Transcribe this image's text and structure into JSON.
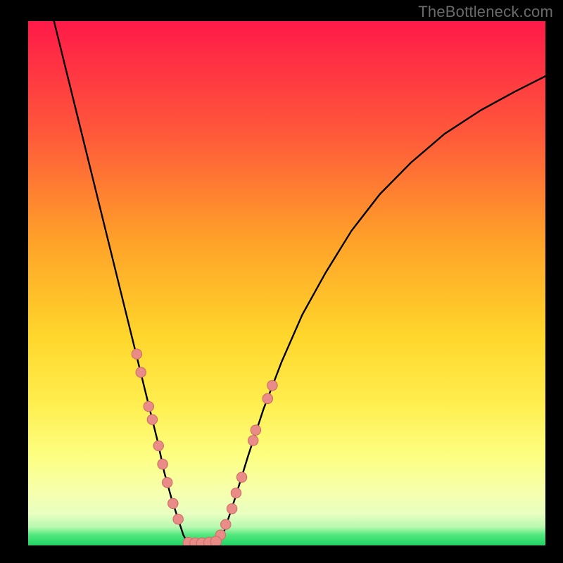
{
  "watermark": "TheBottleneck.com",
  "colors": {
    "bg_black": "#000000",
    "gradient_top": "#ff1a49",
    "gradient_mid1": "#ff7a2e",
    "gradient_mid2": "#ffd52b",
    "gradient_mid3": "#ffee5f",
    "gradient_low": "#f6ff8f",
    "gradient_base_pale": "#f4fec4",
    "gradient_green": "#1ed860",
    "curve": "#000000",
    "marker_fill": "#e98b86",
    "marker_stroke": "#cf6e68"
  },
  "chart_data": {
    "type": "line",
    "title": "",
    "xlabel": "",
    "ylabel": "",
    "xlim": [
      0,
      100
    ],
    "ylim": [
      0,
      100
    ],
    "grid": false,
    "series": [
      {
        "name": "left_branch",
        "x": [
          5,
          7,
          9,
          11,
          13,
          15,
          17,
          19,
          20.5,
          22,
          23.5,
          25,
          26.3,
          27.7,
          29,
          30,
          30.8
        ],
        "y": [
          100,
          92,
          84,
          76,
          68,
          60,
          52,
          44,
          38,
          32,
          26,
          20,
          14,
          9,
          5,
          2,
          0.5
        ]
      },
      {
        "name": "valley_floor",
        "x": [
          30.8,
          32,
          33.2,
          34.5,
          35.6,
          36.8
        ],
        "y": [
          0.5,
          0.2,
          0.2,
          0.2,
          0.3,
          0.6
        ]
      },
      {
        "name": "right_branch",
        "x": [
          36.8,
          38,
          40,
          42.5,
          45.5,
          49,
          53,
          57.5,
          62.5,
          68,
          74,
          80.5,
          87.5,
          94,
          100
        ],
        "y": [
          0.6,
          3,
          9,
          17,
          26,
          35,
          44,
          52,
          60,
          67,
          73,
          78.5,
          83,
          86.5,
          89.5
        ]
      }
    ],
    "markers_left": [
      {
        "x": 21.0,
        "y": 36.5
      },
      {
        "x": 21.8,
        "y": 33.0
      },
      {
        "x": 23.3,
        "y": 26.5
      },
      {
        "x": 24.0,
        "y": 24.0
      },
      {
        "x": 25.2,
        "y": 19.0
      },
      {
        "x": 26.0,
        "y": 15.5
      },
      {
        "x": 26.9,
        "y": 12.0
      },
      {
        "x": 28.0,
        "y": 8.0
      },
      {
        "x": 29.0,
        "y": 5.0
      }
    ],
    "markers_floor": [
      {
        "x": 31.0,
        "y": 0.5
      },
      {
        "x": 32.3,
        "y": 0.4
      },
      {
        "x": 33.6,
        "y": 0.4
      },
      {
        "x": 35.0,
        "y": 0.5
      },
      {
        "x": 36.3,
        "y": 0.7
      }
    ],
    "markers_right": [
      {
        "x": 37.2,
        "y": 2.0
      },
      {
        "x": 38.2,
        "y": 4.0
      },
      {
        "x": 39.4,
        "y": 7.0
      },
      {
        "x": 40.2,
        "y": 10.0
      },
      {
        "x": 41.3,
        "y": 13.0
      },
      {
        "x": 43.5,
        "y": 20.0
      },
      {
        "x": 44.0,
        "y": 22.0
      },
      {
        "x": 46.3,
        "y": 28.0
      },
      {
        "x": 47.2,
        "y": 30.5
      }
    ]
  }
}
